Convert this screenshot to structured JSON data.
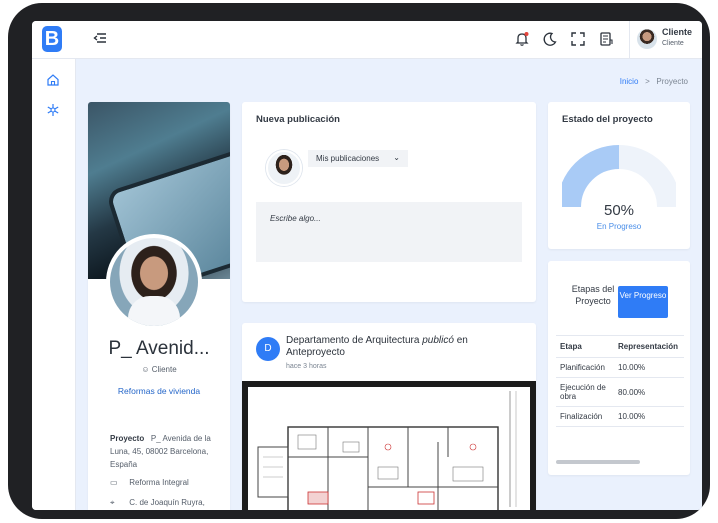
{
  "header": {
    "logo_letter": "B",
    "user_name": "Cliente",
    "user_role": "Cliente",
    "icons": [
      "menu-collapse-icon",
      "bell-icon",
      "moon-icon",
      "fullscreen-icon",
      "notes-icon"
    ]
  },
  "sidebar": {
    "items": [
      {
        "icon": "home-icon"
      },
      {
        "icon": "snowflake-icon"
      }
    ]
  },
  "breadcrumb": {
    "home": "Inicio",
    "separator": ">",
    "current": "Proyecto"
  },
  "profile": {
    "name": "P_ Avenid...",
    "role": "Cliente",
    "link": "Reformas de vivienda",
    "project_label": "Proyecto",
    "project_value": "P_ Avenida de la Luna, 45, 08002 Barcelona, España",
    "type": "Reforma Integral",
    "address": "C. de Joaquín Ruyra,"
  },
  "new_post": {
    "title": "Nueva publicación",
    "audience": "Mis publicaciones",
    "placeholder": "Escribe algo..."
  },
  "project_status": {
    "title": "Estado del proyecto",
    "percent": "50%",
    "label": "En Progreso",
    "progress": 0.5
  },
  "feed": {
    "avatar_letter": "D",
    "author": "Departamento de Arquitectura",
    "action": "publicó",
    "preposition": "en",
    "target": "Anteproyecto",
    "time": "hace 3 horas"
  },
  "stages": {
    "title": "Etapas del Proyecto",
    "button": "Ver Progreso",
    "headers": [
      "Etapa",
      "Representación"
    ],
    "rows": [
      {
        "stage": "Planificación",
        "value": "10.00%"
      },
      {
        "stage": "Ejecución de obra",
        "value": "80.00%"
      },
      {
        "stage": "Finalización",
        "value": "10.00%"
      }
    ]
  },
  "colors": {
    "accent": "#2f7cf6",
    "background": "#eaf1fd",
    "gauge_fill": "#a9cbf6",
    "gauge_track": "#eef3fa"
  }
}
